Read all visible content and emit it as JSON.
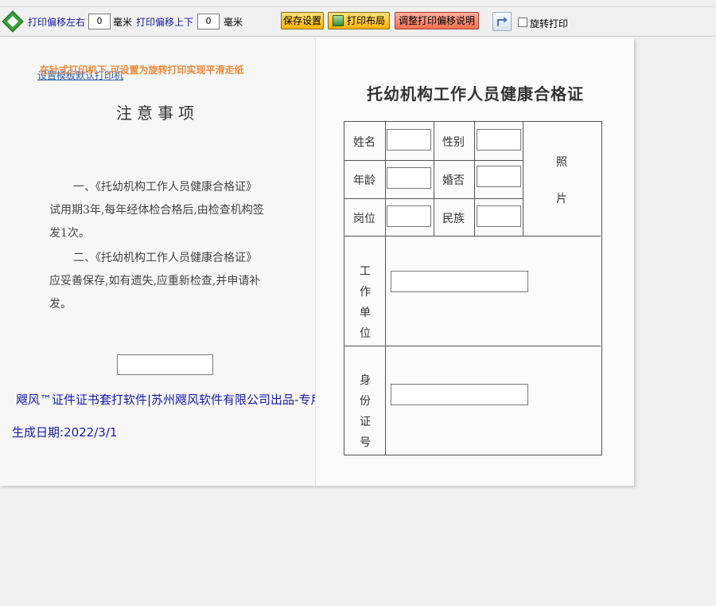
{
  "toolbar": {
    "offset_lr_label": "打印偏移左右",
    "offset_lr_value": "0",
    "offset_ud_label": "打印偏移上下",
    "offset_ud_value": "0",
    "unit": "毫米",
    "save_button": "保存设置",
    "layout_button": "打印布局",
    "offset_help_button": "调整打印偏移说明",
    "rotate_label": "旋转打印",
    "rotate_checked": false
  },
  "left_page": {
    "hint": "在针式打印机下,可设置为旋转打印实现平滑走纸",
    "default_printer_link": "设置模板默认打印机",
    "title": "注意事项",
    "para1": "一、《托幼机构工作人员健康合格证》试用期3年,每年经体检合格后,由检查机构签发1次。",
    "para2": "二、《托幼机构工作人员健康合格证》应妥善保存,如有遗失,应重新检查,并申请补发。",
    "brand": "飕风™证件证书套打软件|苏州飕风软件有限公司出品-专用模版",
    "generated": "生成日期:2022/3/1"
  },
  "right_page": {
    "title": "托幼机构工作人员健康合格证",
    "labels": {
      "name": "姓名",
      "gender": "性别",
      "age": "年龄",
      "married": "婚否",
      "post": "岗位",
      "ethnic": "民族",
      "photo1": "照",
      "photo2": "片",
      "workplace": "工作单位",
      "idno": "身份证号"
    }
  }
}
